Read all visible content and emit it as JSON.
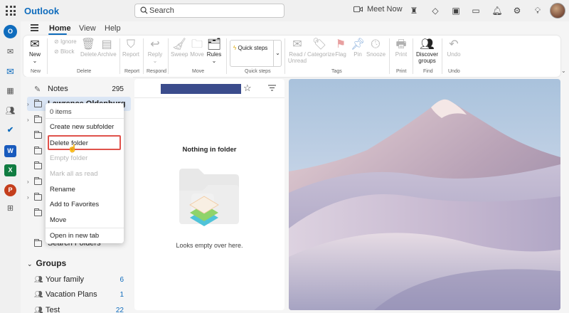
{
  "app": {
    "brand": "Outlook"
  },
  "search": {
    "placeholder": "Search"
  },
  "topbar": {
    "meet_now": "Meet Now"
  },
  "tabs": [
    {
      "label": "Home"
    },
    {
      "label": "View"
    },
    {
      "label": "Help"
    }
  ],
  "ribbon": {
    "new": "New",
    "ignore": "Ignore",
    "block": "Block",
    "delete": "Delete",
    "archive": "Archive",
    "report": "Report",
    "reply": "Reply",
    "sweep": "Sweep",
    "move": "Move",
    "rules": "Rules",
    "quick_steps": "Quick steps",
    "read_unread": "Read / Unread",
    "categorize": "Categorize",
    "flag": "Flag",
    "pin": "Pin",
    "snooze": "Snooze",
    "print": "Print",
    "discover_groups": "Discover groups",
    "undo": "Undo",
    "groups": {
      "new": "New",
      "delete": "Delete",
      "report": "Report",
      "respond": "Respond",
      "move": "Move",
      "quick_steps": "Quick steps",
      "tags": "Tags",
      "print": "Print",
      "find": "Find",
      "undo": "Undo"
    }
  },
  "folders": {
    "notes": {
      "label": "Notes",
      "count": "295"
    },
    "selected_label": "Lawrence Oldenburg",
    "search_folders": "Search Folders"
  },
  "context_menu": {
    "items_count": "0 items",
    "create_subfolder": "Create new subfolder",
    "delete_folder": "Delete folder",
    "empty_folder": "Empty folder",
    "mark_all_read": "Mark all as read",
    "rename": "Rename",
    "add_favorites": "Add to Favorites",
    "move": "Move",
    "open_new_tab": "Open in new tab"
  },
  "groups_section": {
    "title": "Groups",
    "items": [
      {
        "label": "Your family",
        "count": "6"
      },
      {
        "label": "Vacation Plans",
        "count": "1"
      },
      {
        "label": "Test",
        "count": "22"
      }
    ]
  },
  "message_list": {
    "empty_title": "Nothing in folder",
    "empty_subtitle": "Looks empty over here."
  },
  "colors": {
    "accent": "#0f6cbd",
    "highlight": "#e0524b"
  }
}
